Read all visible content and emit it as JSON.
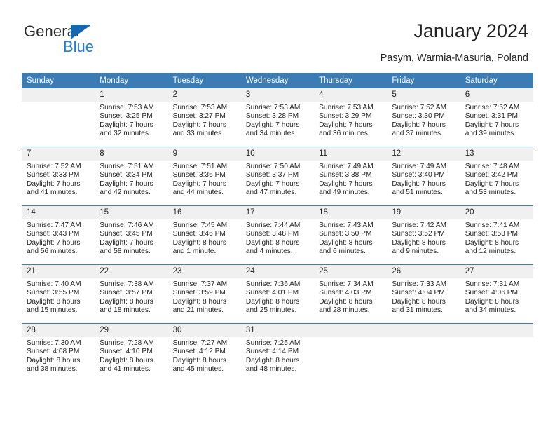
{
  "brand": {
    "name_dark": "General",
    "name_blue": "Blue",
    "icon": "triangle-logo-icon",
    "color_blue": "#1f7fd0",
    "color_triangle": "#1268b3"
  },
  "header": {
    "title": "January 2024",
    "subtitle": "Pasym, Warmia-Masuria, Poland",
    "accent_color": "#3c7cb5",
    "daynum_bg": "#f0f0f0"
  },
  "weekday_headers": [
    "Sunday",
    "Monday",
    "Tuesday",
    "Wednesday",
    "Thursday",
    "Friday",
    "Saturday"
  ],
  "weeks": [
    [
      {
        "day": "",
        "sunrise": "",
        "sunset": "",
        "daylight": "",
        "empty": true
      },
      {
        "day": "1",
        "sunrise": "Sunrise: 7:53 AM",
        "sunset": "Sunset: 3:25 PM",
        "daylight": "Daylight: 7 hours and 32 minutes."
      },
      {
        "day": "2",
        "sunrise": "Sunrise: 7:53 AM",
        "sunset": "Sunset: 3:27 PM",
        "daylight": "Daylight: 7 hours and 33 minutes."
      },
      {
        "day": "3",
        "sunrise": "Sunrise: 7:53 AM",
        "sunset": "Sunset: 3:28 PM",
        "daylight": "Daylight: 7 hours and 34 minutes."
      },
      {
        "day": "4",
        "sunrise": "Sunrise: 7:53 AM",
        "sunset": "Sunset: 3:29 PM",
        "daylight": "Daylight: 7 hours and 36 minutes."
      },
      {
        "day": "5",
        "sunrise": "Sunrise: 7:52 AM",
        "sunset": "Sunset: 3:30 PM",
        "daylight": "Daylight: 7 hours and 37 minutes."
      },
      {
        "day": "6",
        "sunrise": "Sunrise: 7:52 AM",
        "sunset": "Sunset: 3:31 PM",
        "daylight": "Daylight: 7 hours and 39 minutes."
      }
    ],
    [
      {
        "day": "7",
        "sunrise": "Sunrise: 7:52 AM",
        "sunset": "Sunset: 3:33 PM",
        "daylight": "Daylight: 7 hours and 41 minutes."
      },
      {
        "day": "8",
        "sunrise": "Sunrise: 7:51 AM",
        "sunset": "Sunset: 3:34 PM",
        "daylight": "Daylight: 7 hours and 42 minutes."
      },
      {
        "day": "9",
        "sunrise": "Sunrise: 7:51 AM",
        "sunset": "Sunset: 3:36 PM",
        "daylight": "Daylight: 7 hours and 44 minutes."
      },
      {
        "day": "10",
        "sunrise": "Sunrise: 7:50 AM",
        "sunset": "Sunset: 3:37 PM",
        "daylight": "Daylight: 7 hours and 47 minutes."
      },
      {
        "day": "11",
        "sunrise": "Sunrise: 7:49 AM",
        "sunset": "Sunset: 3:38 PM",
        "daylight": "Daylight: 7 hours and 49 minutes."
      },
      {
        "day": "12",
        "sunrise": "Sunrise: 7:49 AM",
        "sunset": "Sunset: 3:40 PM",
        "daylight": "Daylight: 7 hours and 51 minutes."
      },
      {
        "day": "13",
        "sunrise": "Sunrise: 7:48 AM",
        "sunset": "Sunset: 3:42 PM",
        "daylight": "Daylight: 7 hours and 53 minutes."
      }
    ],
    [
      {
        "day": "14",
        "sunrise": "Sunrise: 7:47 AM",
        "sunset": "Sunset: 3:43 PM",
        "daylight": "Daylight: 7 hours and 56 minutes."
      },
      {
        "day": "15",
        "sunrise": "Sunrise: 7:46 AM",
        "sunset": "Sunset: 3:45 PM",
        "daylight": "Daylight: 7 hours and 58 minutes."
      },
      {
        "day": "16",
        "sunrise": "Sunrise: 7:45 AM",
        "sunset": "Sunset: 3:46 PM",
        "daylight": "Daylight: 8 hours and 1 minute."
      },
      {
        "day": "17",
        "sunrise": "Sunrise: 7:44 AM",
        "sunset": "Sunset: 3:48 PM",
        "daylight": "Daylight: 8 hours and 4 minutes."
      },
      {
        "day": "18",
        "sunrise": "Sunrise: 7:43 AM",
        "sunset": "Sunset: 3:50 PM",
        "daylight": "Daylight: 8 hours and 6 minutes."
      },
      {
        "day": "19",
        "sunrise": "Sunrise: 7:42 AM",
        "sunset": "Sunset: 3:52 PM",
        "daylight": "Daylight: 8 hours and 9 minutes."
      },
      {
        "day": "20",
        "sunrise": "Sunrise: 7:41 AM",
        "sunset": "Sunset: 3:53 PM",
        "daylight": "Daylight: 8 hours and 12 minutes."
      }
    ],
    [
      {
        "day": "21",
        "sunrise": "Sunrise: 7:40 AM",
        "sunset": "Sunset: 3:55 PM",
        "daylight": "Daylight: 8 hours and 15 minutes."
      },
      {
        "day": "22",
        "sunrise": "Sunrise: 7:38 AM",
        "sunset": "Sunset: 3:57 PM",
        "daylight": "Daylight: 8 hours and 18 minutes."
      },
      {
        "day": "23",
        "sunrise": "Sunrise: 7:37 AM",
        "sunset": "Sunset: 3:59 PM",
        "daylight": "Daylight: 8 hours and 21 minutes."
      },
      {
        "day": "24",
        "sunrise": "Sunrise: 7:36 AM",
        "sunset": "Sunset: 4:01 PM",
        "daylight": "Daylight: 8 hours and 25 minutes."
      },
      {
        "day": "25",
        "sunrise": "Sunrise: 7:34 AM",
        "sunset": "Sunset: 4:03 PM",
        "daylight": "Daylight: 8 hours and 28 minutes."
      },
      {
        "day": "26",
        "sunrise": "Sunrise: 7:33 AM",
        "sunset": "Sunset: 4:04 PM",
        "daylight": "Daylight: 8 hours and 31 minutes."
      },
      {
        "day": "27",
        "sunrise": "Sunrise: 7:31 AM",
        "sunset": "Sunset: 4:06 PM",
        "daylight": "Daylight: 8 hours and 34 minutes."
      }
    ],
    [
      {
        "day": "28",
        "sunrise": "Sunrise: 7:30 AM",
        "sunset": "Sunset: 4:08 PM",
        "daylight": "Daylight: 8 hours and 38 minutes."
      },
      {
        "day": "29",
        "sunrise": "Sunrise: 7:28 AM",
        "sunset": "Sunset: 4:10 PM",
        "daylight": "Daylight: 8 hours and 41 minutes."
      },
      {
        "day": "30",
        "sunrise": "Sunrise: 7:27 AM",
        "sunset": "Sunset: 4:12 PM",
        "daylight": "Daylight: 8 hours and 45 minutes."
      },
      {
        "day": "31",
        "sunrise": "Sunrise: 7:25 AM",
        "sunset": "Sunset: 4:14 PM",
        "daylight": "Daylight: 8 hours and 48 minutes."
      },
      {
        "day": "",
        "sunrise": "",
        "sunset": "",
        "daylight": "",
        "empty": true
      },
      {
        "day": "",
        "sunrise": "",
        "sunset": "",
        "daylight": "",
        "empty": true
      },
      {
        "day": "",
        "sunrise": "",
        "sunset": "",
        "daylight": "",
        "empty": true
      }
    ]
  ]
}
